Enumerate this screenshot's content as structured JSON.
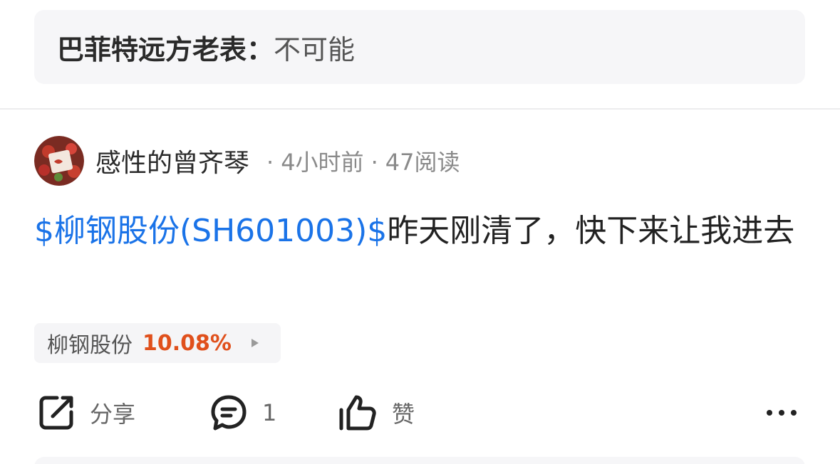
{
  "quote": {
    "author": "巴菲特远方老表：",
    "text": "不可能"
  },
  "post": {
    "username": "感性的曾齐琴",
    "time_ago": "4小时前",
    "read_count": "47阅读",
    "separator": "·",
    "stock_link_text": "$柳钢股份(SH601003)$",
    "body_text": "昨天刚清了，快下来让我进去"
  },
  "stock_chip": {
    "name": "柳钢股份",
    "change": "10.08%",
    "change_color": "#e0501c"
  },
  "actions": {
    "share_label": "分享",
    "comment_count": "1",
    "like_label": "赞",
    "more_icon": "more-horizontal-icon"
  },
  "colors": {
    "link": "#1a73e8",
    "quote_bg": "#f6f6f8"
  }
}
